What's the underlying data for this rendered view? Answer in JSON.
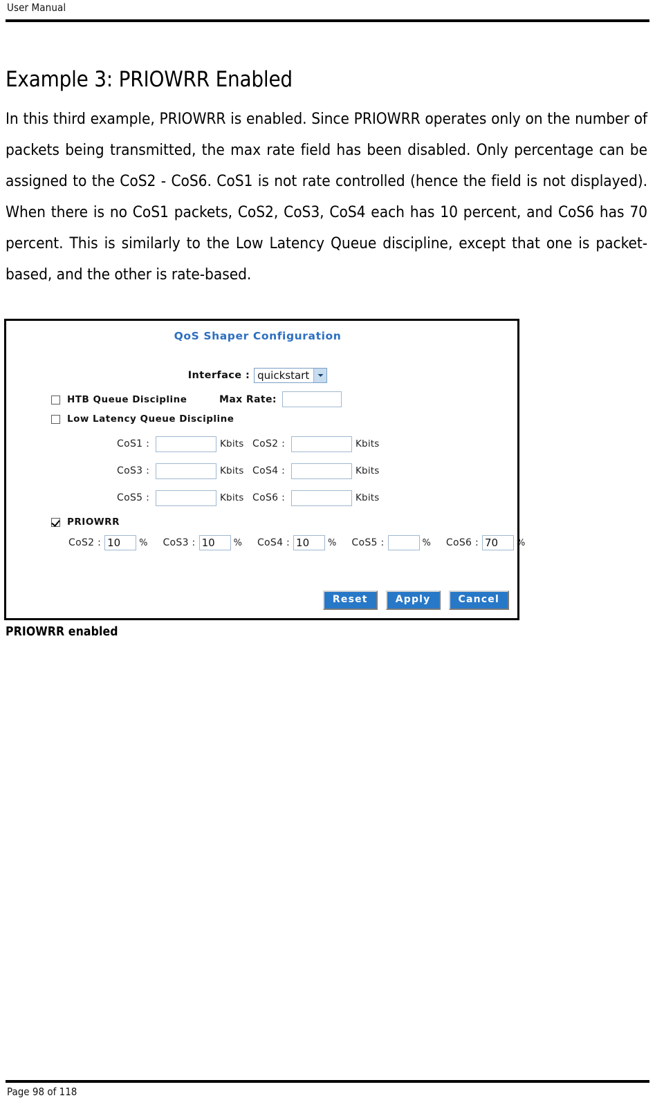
{
  "header": {
    "title": "User Manual"
  },
  "section": {
    "heading": "Example 3: PRIOWRR Enabled",
    "paragraph": "In this third example, PRIOWRR is enabled. Since PRIOWRR operates only on the number of packets being transmitted, the max rate field has been disabled. Only percentage can be assigned to the CoS2 - CoS6. CoS1 is not rate controlled (hence the field is not displayed). When there is no CoS1 packets, CoS2, CoS3, CoS4 each has 10 percent, and CoS6 has 70 percent. This is similarly to the Low Latency Queue discipline, except that one is packet-based, and the other is rate-based."
  },
  "figure": {
    "caption": "PRIOWRR enabled",
    "title": "QoS Shaper Configuration",
    "title_color": "#2d6fc0",
    "interface": {
      "label": "Interface :",
      "value": "quickstart",
      "arrow_icon": "chevron-down-icon"
    },
    "disciplines": [
      {
        "label": "HTB Queue Discipline",
        "checked": false
      },
      {
        "label": "Low Latency Queue Discipline",
        "checked": false
      }
    ],
    "max_rate": {
      "label": "Max Rate:",
      "value": "",
      "placeholder": ""
    },
    "cos_rates": {
      "unit": "Kbits",
      "fields": [
        {
          "label": "CoS1 :",
          "value": ""
        },
        {
          "label": "CoS2 :",
          "value": ""
        },
        {
          "label": "CoS3 :",
          "value": ""
        },
        {
          "label": "CoS4 :",
          "value": ""
        },
        {
          "label": "CoS5 :",
          "value": ""
        },
        {
          "label": "CoS6 :",
          "value": ""
        }
      ]
    },
    "priowrr": {
      "label": "PRIOWRR",
      "checked": true,
      "unit": "%",
      "fields": [
        {
          "label": "CoS2 :",
          "value": "10"
        },
        {
          "label": "CoS3 :",
          "value": "10"
        },
        {
          "label": "CoS4 :",
          "value": "10"
        },
        {
          "label": "CoS5 :",
          "value": ""
        },
        {
          "label": "CoS6 :",
          "value": "70"
        }
      ]
    },
    "buttons": {
      "reset": "Reset",
      "apply": "Apply",
      "cancel": "Cancel",
      "color": "#2878c8"
    }
  },
  "footer": {
    "page_label": "Page 98  of 118"
  }
}
